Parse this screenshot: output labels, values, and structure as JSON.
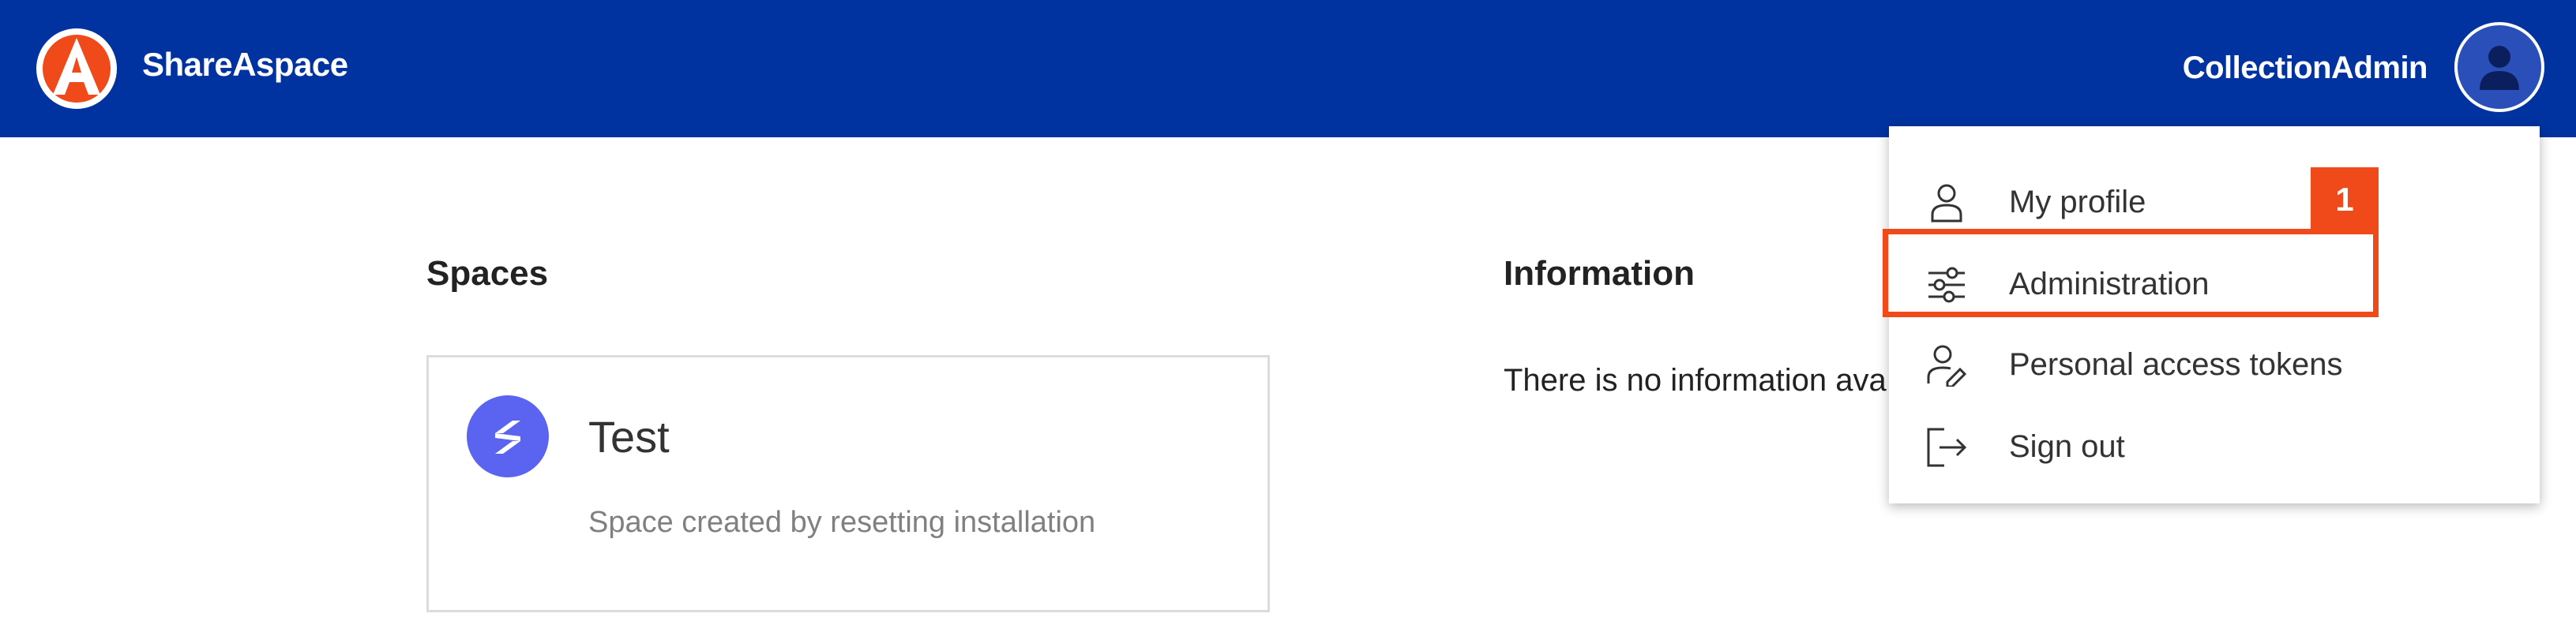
{
  "header": {
    "brand": "ShareAspace",
    "username": "CollectionAdmin",
    "logo_icon": "shareaspace-a-logo-icon",
    "avatar_icon": "user-avatar-icon",
    "background_color": "#0033a0"
  },
  "spaces": {
    "title": "Spaces",
    "cards": [
      {
        "name": "Test",
        "description": "Space created by resetting installation",
        "icon": "space-icon",
        "icon_color": "#5a64f0"
      }
    ]
  },
  "information": {
    "title": "Information",
    "text": "There is no information ava"
  },
  "user_menu": {
    "items": [
      {
        "label": "My profile",
        "icon": "person-icon"
      },
      {
        "label": "Administration",
        "icon": "sliders-icon"
      },
      {
        "label": "Personal access tokens",
        "icon": "person-key-icon"
      },
      {
        "label": "Sign out",
        "icon": "sign-out-icon"
      }
    ]
  },
  "annotation": {
    "badge": "1",
    "color": "#f04a1a"
  }
}
